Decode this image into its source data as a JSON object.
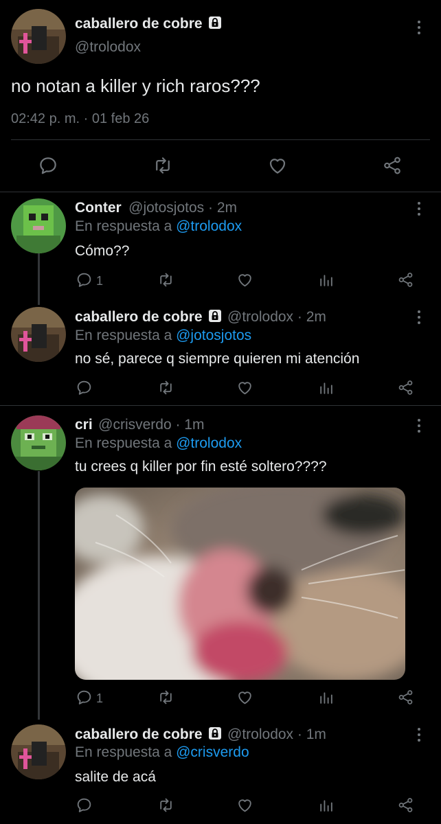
{
  "main_tweet": {
    "author_name": "caballero de cobre",
    "handle": "@trolodox",
    "text": "no notan a killer y rich raros???",
    "timestamp": "02:42 p. m. · 01 feb 26"
  },
  "replies": [
    {
      "author_name": "Conter",
      "handle_time": "@jotosjotos · 2m",
      "reply_prefix": "En respuesta a",
      "reply_to": "@trolodox",
      "text": "Cómo??",
      "reply_count": "1"
    },
    {
      "author_name": "caballero de cobre",
      "handle_time": "@trolodox · 2m",
      "reply_prefix": "En respuesta a",
      "reply_to": "@jotosjotos",
      "text": "no sé, parece q siempre quieren mi atención",
      "reply_count": ""
    },
    {
      "author_name": "cri",
      "handle_time": "@crisverdo · 1m",
      "reply_prefix": "En respuesta a",
      "reply_to": "@trolodox",
      "text": "tu crees q killer por fin esté soltero????",
      "reply_count": "1"
    },
    {
      "author_name": "caballero de cobre",
      "handle_time": "@trolodox · 1m",
      "reply_prefix": "En respuesta a",
      "reply_to": "@crisverdo",
      "text": "salite de acá",
      "reply_count": ""
    }
  ],
  "icons": {
    "reply": "reply-icon",
    "retweet": "retweet-icon",
    "like": "heart-icon",
    "views": "views-icon",
    "share": "share-icon",
    "more": "more-icon",
    "lock": "lock-icon"
  },
  "colors": {
    "background": "#000000",
    "link": "#1d9bf0",
    "muted": "#71767b",
    "text": "#e7e9ea"
  }
}
